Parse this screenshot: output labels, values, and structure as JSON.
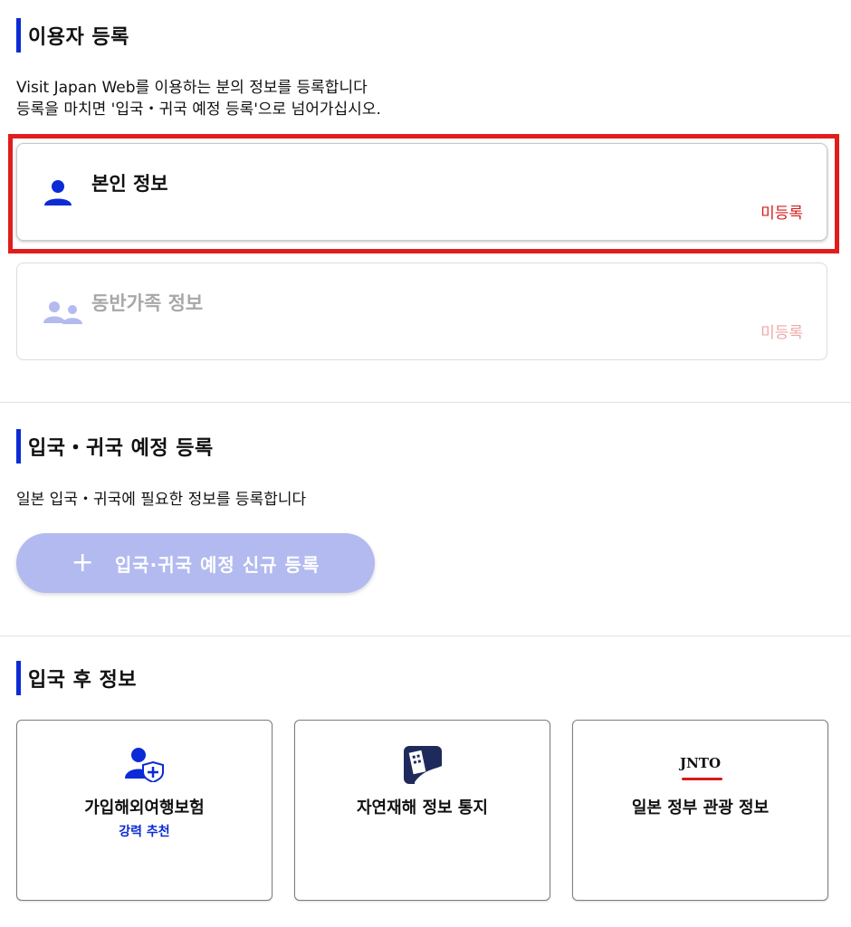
{
  "user_registration": {
    "title": "이용자 등록",
    "desc_line1": "Visit Japan Web를 이용하는 분의 정보를 등록합니다",
    "desc_line2": "등록을 마치면 '입국・귀국 예정 등록'으로 넘어가십시오.",
    "self_card": {
      "title": "본인 정보",
      "status": "미등록",
      "icon": "person-icon"
    },
    "companion_card": {
      "title": "동반가족 정보",
      "status": "미등록",
      "icon": "family-icon"
    }
  },
  "schedule": {
    "title": "입국・귀국 예정 등록",
    "desc": "일본 입국・귀국에 필요한 정보를 등록합니다",
    "new_button_label": "입국·귀국 예정 신규 등록",
    "new_button_icon": "plus-icon"
  },
  "after_entry": {
    "title": "입국 후 정보",
    "tiles": [
      {
        "label": "가입해외여행보험",
        "sub": "강력 추천",
        "icon": "insurance-icon"
      },
      {
        "label": "자연재해 정보 통지",
        "icon": "disaster-icon"
      },
      {
        "label": "일본 정부 관광 정보",
        "logo": "JNTO",
        "icon": "jnto-logo"
      }
    ]
  },
  "colors": {
    "accent_blue": "#0a2bd6",
    "alert_red": "#d61a1a",
    "highlight_red": "#e01d1d",
    "disabled_button": "#b3baf0"
  }
}
